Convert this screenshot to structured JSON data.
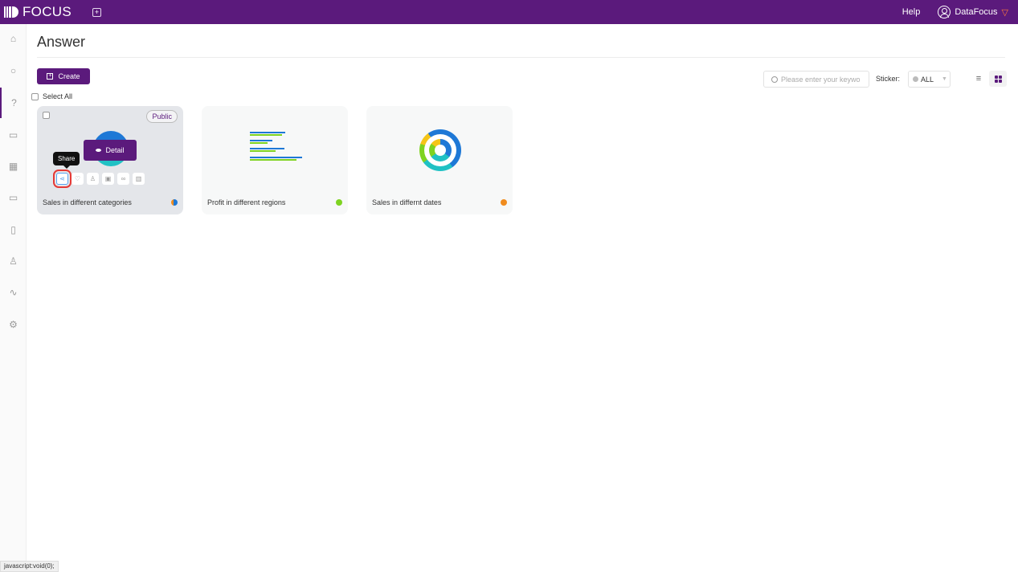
{
  "topbar": {
    "brand": "FOCUS",
    "new_tab_icon": "plus-square-icon",
    "help_label": "Help",
    "user_name": "DataFocus",
    "user_icon": "user-circle-icon",
    "vip_icon": "gem-icon",
    "bg_color": "#5b1a7c"
  },
  "sidebar": {
    "items": [
      {
        "name": "home",
        "icon": "home-icon"
      },
      {
        "name": "search",
        "icon": "search-icon"
      },
      {
        "name": "answer",
        "icon": "question-icon",
        "active": true
      },
      {
        "name": "dashboard",
        "icon": "presentation-icon"
      },
      {
        "name": "data",
        "icon": "table-icon"
      },
      {
        "name": "folder",
        "icon": "folder-icon"
      },
      {
        "name": "tasks",
        "icon": "clipboard-icon"
      },
      {
        "name": "users",
        "icon": "user-icon"
      },
      {
        "name": "monitor",
        "icon": "pulse-icon"
      },
      {
        "name": "settings",
        "icon": "gear-icon"
      }
    ]
  },
  "page": {
    "title": "Answer",
    "create_label": "Create",
    "select_all_label": "Select All",
    "search_placeholder": "Please enter your keywo",
    "sticker_label": "Sticker:",
    "sticker_value": "ALL"
  },
  "cards": [
    {
      "title": "Sales in different categories",
      "sticker_color": "#1e78d6",
      "badge": "Public",
      "chart": "pie",
      "hovered": true
    },
    {
      "title": "Profit in different regions",
      "sticker_color": "#7ed321",
      "chart": "bar"
    },
    {
      "title": "Sales in differnt dates",
      "sticker_color": "#f08c1e",
      "chart": "donut"
    }
  ],
  "hover": {
    "detail_label": "Detail",
    "tooltip": "Share",
    "actions": [
      "share",
      "favorite",
      "assign-user",
      "image",
      "link",
      "delete"
    ]
  },
  "statusbar": {
    "text": "javascript:void(0);"
  }
}
